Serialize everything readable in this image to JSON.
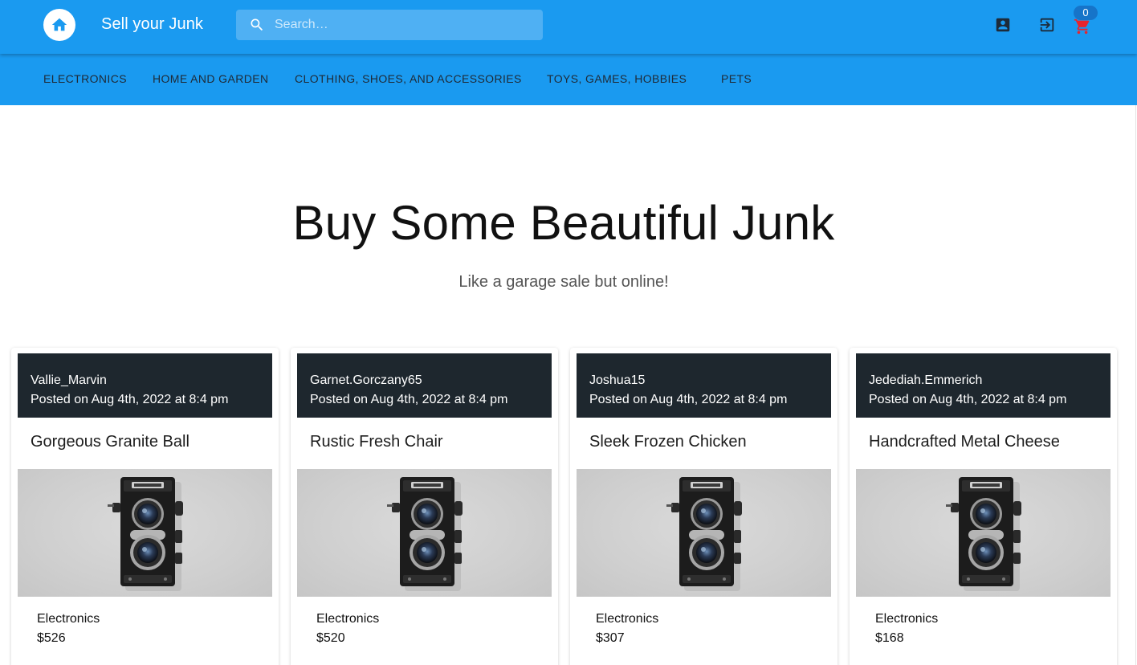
{
  "header": {
    "brand": "Sell your Junk",
    "search_placeholder": "Search…",
    "cart_count": "0",
    "colors": {
      "appbar": "#1a9af0",
      "cart_icon": "#e8242e",
      "badge": "#1674c9"
    },
    "icons": [
      "home-icon",
      "search-icon",
      "account-icon",
      "login-icon",
      "cart-icon"
    ]
  },
  "categories": [
    "Electronics",
    "Home and Garden",
    "Clothing, Shoes, and Accessories",
    "Toys, Games, Hobbies",
    "Pets"
  ],
  "hero": {
    "title": "Buy Some Beautiful Junk",
    "subtitle": "Like a garage sale but online!"
  },
  "listings": [
    {
      "seller": "Vallie_Marvin",
      "posted": "Posted on Aug 4th, 2022 at 8:4 pm",
      "title": "Gorgeous Granite Ball",
      "category": "Electronics",
      "price": "$526"
    },
    {
      "seller": "Garnet.Gorczany65",
      "posted": "Posted on Aug 4th, 2022 at 8:4 pm",
      "title": "Rustic Fresh Chair",
      "category": "Electronics",
      "price": "$520"
    },
    {
      "seller": "Joshua15",
      "posted": "Posted on Aug 4th, 2022 at 8:4 pm",
      "title": "Sleek Frozen Chicken",
      "category": "Electronics",
      "price": "$307"
    },
    {
      "seller": "Jedediah.Emmerich",
      "posted": "Posted on Aug 4th, 2022 at 8:4 pm",
      "title": "Handcrafted Metal Cheese",
      "category": "Electronics",
      "price": "$168"
    }
  ]
}
